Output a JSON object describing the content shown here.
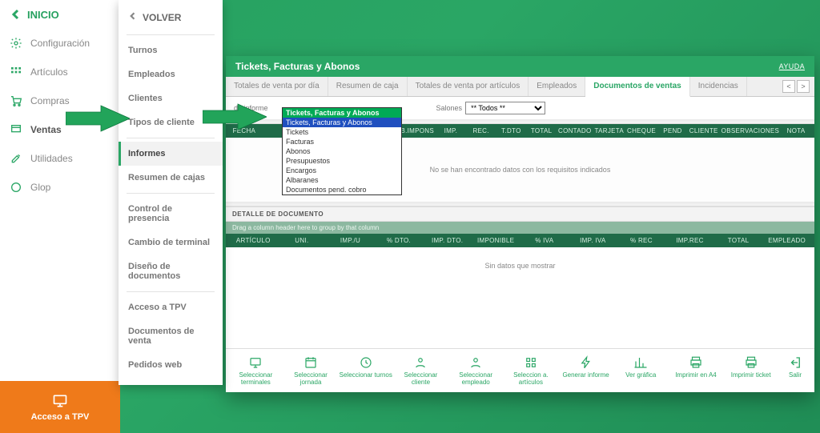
{
  "sidebar": {
    "back_label": "INICIO",
    "items": [
      {
        "label": "Configuración",
        "icon": "gear-icon"
      },
      {
        "label": "Artículos",
        "icon": "grid-icon"
      },
      {
        "label": "Compras",
        "icon": "cart-icon"
      },
      {
        "label": "Ventas",
        "icon": "ventas-icon",
        "active": true
      },
      {
        "label": "Utilidades",
        "icon": "tools-icon"
      },
      {
        "label": "Glop",
        "icon": "glop-icon"
      }
    ]
  },
  "tpv_button": "Acceso a TPV",
  "panel2": {
    "back_label": "VOLVER",
    "groups": [
      [
        "Turnos",
        "Empleados",
        "Clientes",
        "Tipos de cliente"
      ],
      [
        "Informes",
        "Resumen de cajas"
      ],
      [
        "Control de presencia",
        "Cambio de terminal",
        "Diseño de documentos"
      ],
      [
        "Acceso a TPV",
        "Documentos de venta",
        "Pedidos web"
      ]
    ],
    "selected": "Informes"
  },
  "window": {
    "title": "Tickets, Facturas y Abonos",
    "help": "AYUDA",
    "tabs": [
      "Totales de venta por día",
      "Resumen de caja",
      "Totales de venta por artículos",
      "Empleados",
      "Documentos de ventas",
      "Incidencias"
    ],
    "active_tab": 4,
    "filters": {
      "informe_label": "de informe",
      "informe_selected": "Tickets, Facturas y Abonos",
      "informe_options": [
        "Tickets, Facturas y Abonos",
        "Tickets",
        "Facturas",
        "Abonos",
        "Presupuestos",
        "Encargos",
        "Albaranes",
        "Documentos pend. cobro"
      ],
      "salones_label": "Salones",
      "salones_selected": "** Todos **"
    },
    "grid1_headers": [
      "FECHA",
      "",
      "",
      "",
      "",
      "COD. B.IMPONS",
      "IMP.",
      "REC.",
      "T.DTO",
      "TOTAL",
      "CONTADO",
      "TARJETA",
      "CHEQUE",
      "PEND",
      "CLIENTE",
      "OBSERVACIONES",
      "NOTA"
    ],
    "grid1_empty": "No se han encontrado datos con los requisitos indicados",
    "detail_label": "DETALLE DE DOCUMENTO",
    "drag_hint": "Drag a column header here to group by that column",
    "grid2_headers": [
      "ARTÍCULO",
      "UNI.",
      "IMP./U",
      "% DTO.",
      "IMP. DTO.",
      "IMPONIBLE",
      "% IVA",
      "IMP. IVA",
      "% REC",
      "IMP.REC",
      "TOTAL",
      "EMPLEADO"
    ],
    "grid2_empty": "Sin datos que mostrar",
    "toolbar": [
      {
        "label": "Seleccionar terminales",
        "icon": "terminal-icon"
      },
      {
        "label": "Seleccionar jornada",
        "icon": "calendar-icon"
      },
      {
        "label": "Seleccionar turnos",
        "icon": "clock-icon"
      },
      {
        "label": "Seleccionar cliente",
        "icon": "user-icon"
      },
      {
        "label": "Seleccionar empleado",
        "icon": "user-icon"
      },
      {
        "label": "Seleccion a. artículos",
        "icon": "articles-icon"
      },
      {
        "label": "Generar informe",
        "icon": "bolt-icon"
      },
      {
        "label": "Ver gráfica",
        "icon": "chart-icon"
      },
      {
        "label": "Imprimir en A4",
        "icon": "print-icon"
      },
      {
        "label": "Imprimir ticket",
        "icon": "print-icon"
      }
    ],
    "exit_label": "Salir"
  }
}
